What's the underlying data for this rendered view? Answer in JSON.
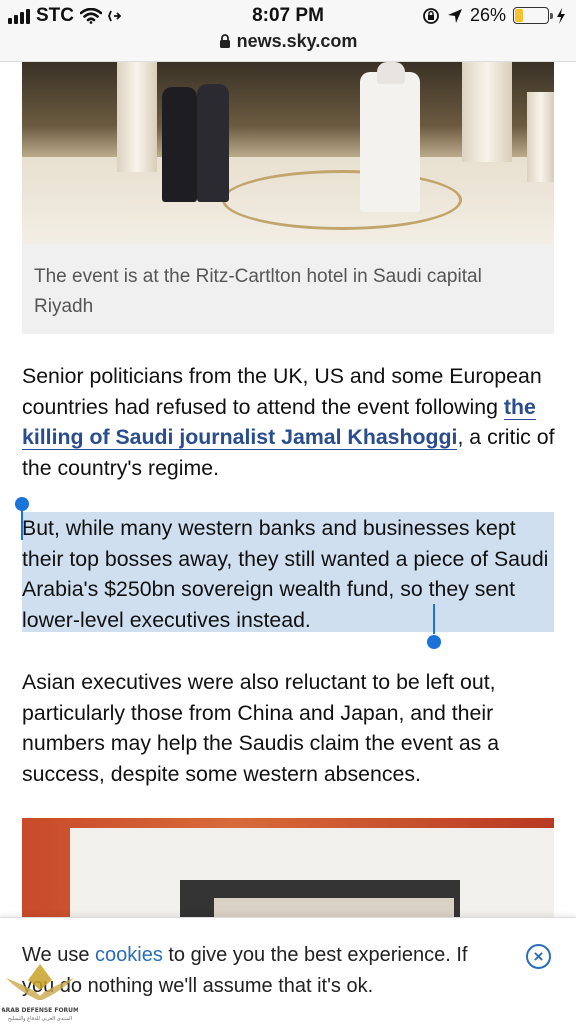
{
  "status_bar": {
    "carrier": "STC",
    "time": "8:07 PM",
    "battery": "26%",
    "battery_level": 0.26
  },
  "url_bar": {
    "domain": "news.sky.com"
  },
  "article": {
    "hero_caption": "The event is at the Ritz-Cartlton hotel in Saudi capital Riyadh",
    "p1_before": "Senior politicians from the UK, US and some European countries had refused to attend the event following ",
    "p1_link": "the killing of Saudi journalist Jamal Khashoggi",
    "p1_after": ", a critic of the country's regime.",
    "p2": "But, while many western banks and businesses kept their top bosses away, they still wanted a piece of Saudi Arabia's $250bn sovereign wealth fund, so they sent lower-level executives instead.",
    "p3": "Asian executives were also reluctant to be left out, particularly those from China and Japan, and their numbers may help the Saudis claim the event as a success, despite some western absences."
  },
  "cookie_banner": {
    "text_before": "We use ",
    "link": "cookies",
    "text_after": " to give you the best experience. If you do nothing we'll assume that it's ok.",
    "close_symbol": "×"
  },
  "watermark": {
    "label": "ARAB DEFENSE FORUM"
  },
  "colors": {
    "link": "#2a4d8f",
    "selection": "#cfdff0",
    "handle": "#1a73d9",
    "battery": "#f4c430"
  }
}
